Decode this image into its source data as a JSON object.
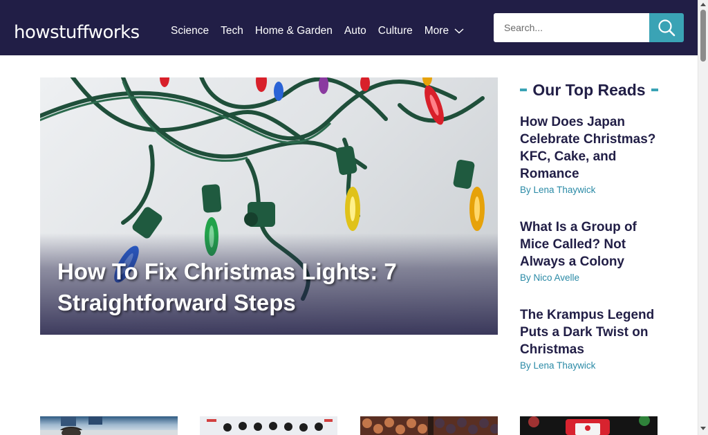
{
  "header": {
    "logo_text": "howstuffworks",
    "nav": [
      {
        "label": "Science"
      },
      {
        "label": "Tech"
      },
      {
        "label": "Home & Garden"
      },
      {
        "label": "Auto"
      },
      {
        "label": "Culture"
      },
      {
        "label": "More"
      }
    ],
    "search_placeholder": "Search...",
    "colors": {
      "bar": "#211e46",
      "accent": "#3aa3b5"
    }
  },
  "hero": {
    "title": "How To Fix Christmas Lights: 7 Straightforward Steps"
  },
  "sidebar": {
    "heading": "Our Top Reads",
    "items": [
      {
        "title": "How Does Japan Celebrate Christmas? KFC, Cake, and Romance",
        "by": "By",
        "author": "Lena Thaywick"
      },
      {
        "title": "What Is a Group of Mice Called? Not Always a Colony",
        "by": "By",
        "author": "Nico Avelle"
      },
      {
        "title": "The Krampus Legend Puts a Dark Twist on Christmas",
        "by": "By",
        "author": "Lena Thaywick"
      }
    ]
  },
  "icons": [
    "search-icon",
    "chevron-down-icon"
  ]
}
